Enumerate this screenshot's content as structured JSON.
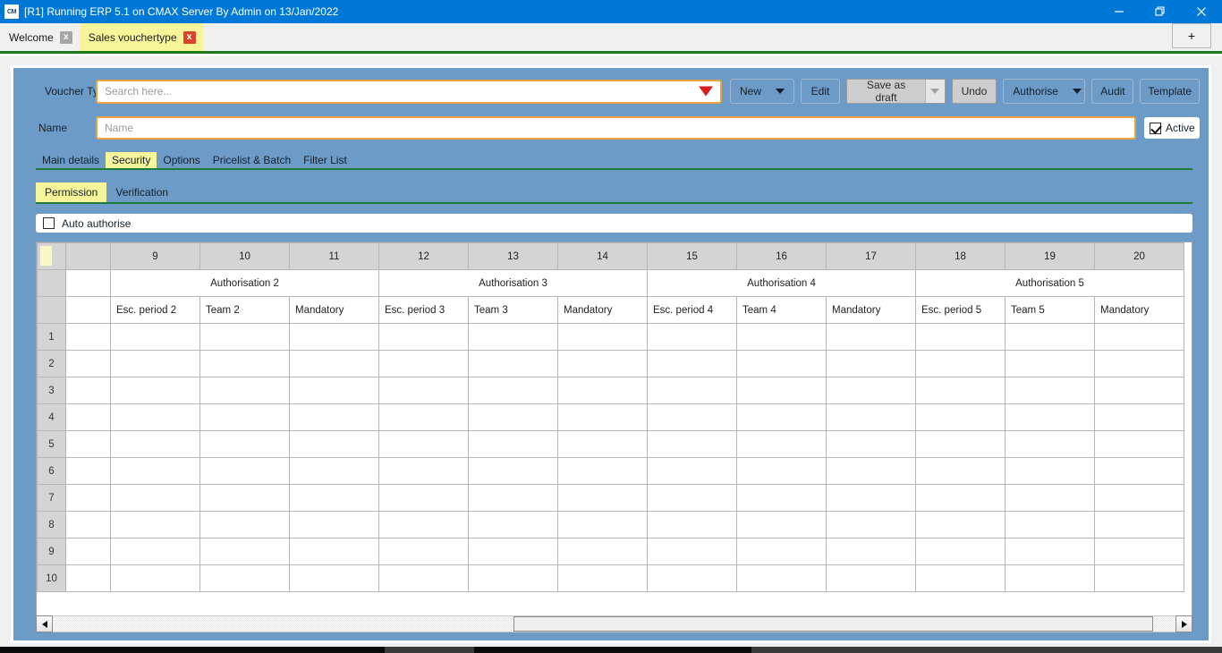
{
  "titlebar": {
    "app_icon_label": "CM",
    "title": "[R1] Running ERP 5.1 on CMAX Server By Admin on 13/Jan/2022",
    "minimize_label": "Minimize",
    "restore_label": "Restore",
    "close_label": "Close",
    "accent_color": "#0078d7"
  },
  "tabstrip": {
    "tabs": [
      {
        "label": "Welcome",
        "active": false,
        "close_label": "x"
      },
      {
        "label": "Sales vouchertype",
        "active": true,
        "close_label": "x"
      }
    ],
    "new_tab_label": "+",
    "active_tab_color": "#f6f59a",
    "underline_color": "#1a7a1a"
  },
  "form": {
    "voucher_type_label": "Voucher Type",
    "search_placeholder": "Search here...",
    "search_value": "",
    "name_label": "Name",
    "name_placeholder": "Name",
    "name_value": "",
    "active_label": "Active",
    "active_checked": true,
    "field_border_color": "#e8a33d",
    "caret_color": "#d81f1f"
  },
  "toolbar": {
    "new_label": "New",
    "edit_label": "Edit",
    "save_as_draft_label": "Save as draft",
    "undo_label": "Undo",
    "authorise_label": "Authorise",
    "audit_label": "Audit",
    "template_label": "Template"
  },
  "main_tabs": [
    {
      "label": "Main details",
      "active": false
    },
    {
      "label": "Security",
      "active": true
    },
    {
      "label": "Options",
      "active": false
    },
    {
      "label": "Pricelist & Batch",
      "active": false
    },
    {
      "label": "Filter List",
      "active": false
    }
  ],
  "sub_tabs": [
    {
      "label": "Permission",
      "active": true
    },
    {
      "label": "Verification",
      "active": false
    }
  ],
  "auto_authorise": {
    "label": "Auto authorise",
    "checked": false
  },
  "grid": {
    "column_numbers": [
      "9",
      "10",
      "11",
      "12",
      "13",
      "14",
      "15",
      "16",
      "17",
      "18",
      "19",
      "20"
    ],
    "groups": [
      {
        "label": "Authorisation 2",
        "span": 3
      },
      {
        "label": "Authorisation 3",
        "span": 3
      },
      {
        "label": "Authorisation 4",
        "span": 3
      },
      {
        "label": "Authorisation 5",
        "span": 3
      }
    ],
    "sub_headers": [
      "Esc. period 2",
      "Team 2",
      "Mandatory",
      "Esc. period 3",
      "Team 3",
      "Mandatory",
      "Esc. period 4",
      "Team 4",
      "Mandatory",
      "Esc. period 5",
      "Team 5",
      "Mandatory"
    ],
    "row_numbers": [
      "1",
      "2",
      "3",
      "4",
      "5",
      "6",
      "7",
      "8",
      "9",
      "10"
    ],
    "rows": [
      [
        "",
        "",
        "",
        "",
        "",
        "",
        "",
        "",
        "",
        "",
        "",
        ""
      ],
      [
        "",
        "",
        "",
        "",
        "",
        "",
        "",
        "",
        "",
        "",
        "",
        ""
      ],
      [
        "",
        "",
        "",
        "",
        "",
        "",
        "",
        "",
        "",
        "",
        "",
        ""
      ],
      [
        "",
        "",
        "",
        "",
        "",
        "",
        "",
        "",
        "",
        "",
        "",
        ""
      ],
      [
        "",
        "",
        "",
        "",
        "",
        "",
        "",
        "",
        "",
        "",
        "",
        ""
      ],
      [
        "",
        "",
        "",
        "",
        "",
        "",
        "",
        "",
        "",
        "",
        "",
        ""
      ],
      [
        "",
        "",
        "",
        "",
        "",
        "",
        "",
        "",
        "",
        "",
        "",
        ""
      ],
      [
        "",
        "",
        "",
        "",
        "",
        "",
        "",
        "",
        "",
        "",
        "",
        ""
      ],
      [
        "",
        "",
        "",
        "",
        "",
        "",
        "",
        "",
        "",
        "",
        "",
        ""
      ],
      [
        "",
        "",
        "",
        "",
        "",
        "",
        "",
        "",
        "",
        "",
        "",
        ""
      ]
    ]
  },
  "scrollbar": {
    "left_arrow": "left-arrow",
    "right_arrow": "right-arrow",
    "thumb_left_pct": 41,
    "thumb_width_pct": 57
  }
}
